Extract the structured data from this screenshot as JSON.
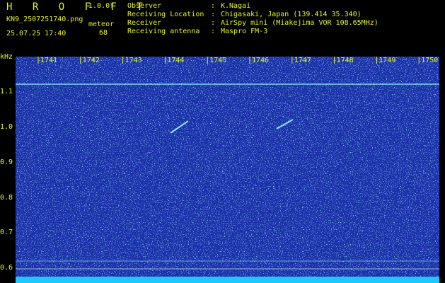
{
  "header": {
    "brand": "H R O F F T",
    "version": "1.0.0f",
    "filename": "KN9_2507251740.png",
    "datetime": "25.07.25 17:40",
    "counter_label": "meteor",
    "counter_value": "68"
  },
  "info": [
    {
      "label": "Observer",
      "value": "K.Nagai"
    },
    {
      "label": "Receiving Location",
      "value": "Chigasaki, Japan (139.414 35.340)"
    },
    {
      "label": "Receiver",
      "value": "AirSpy mini (Miakejima VOR 108.65MHz)"
    },
    {
      "label": "Receiving antenna",
      "value": "Maspro FM-3"
    }
  ],
  "axis": {
    "y_unit": "kHz",
    "y_ticks": [
      "1.1",
      "1.0",
      "0.9",
      "0.8",
      "0.7",
      "0.6"
    ],
    "minute_ticks": [
      "1741",
      "1742",
      "1743",
      "1744",
      "1745",
      "1746",
      "1747",
      "1748",
      "1749",
      "1750"
    ]
  },
  "colors": {
    "text": "#e9f51a",
    "background": "#1a2fa8",
    "signal": "#8ee7ff",
    "bottom_bar": "#1ec8ff"
  }
}
